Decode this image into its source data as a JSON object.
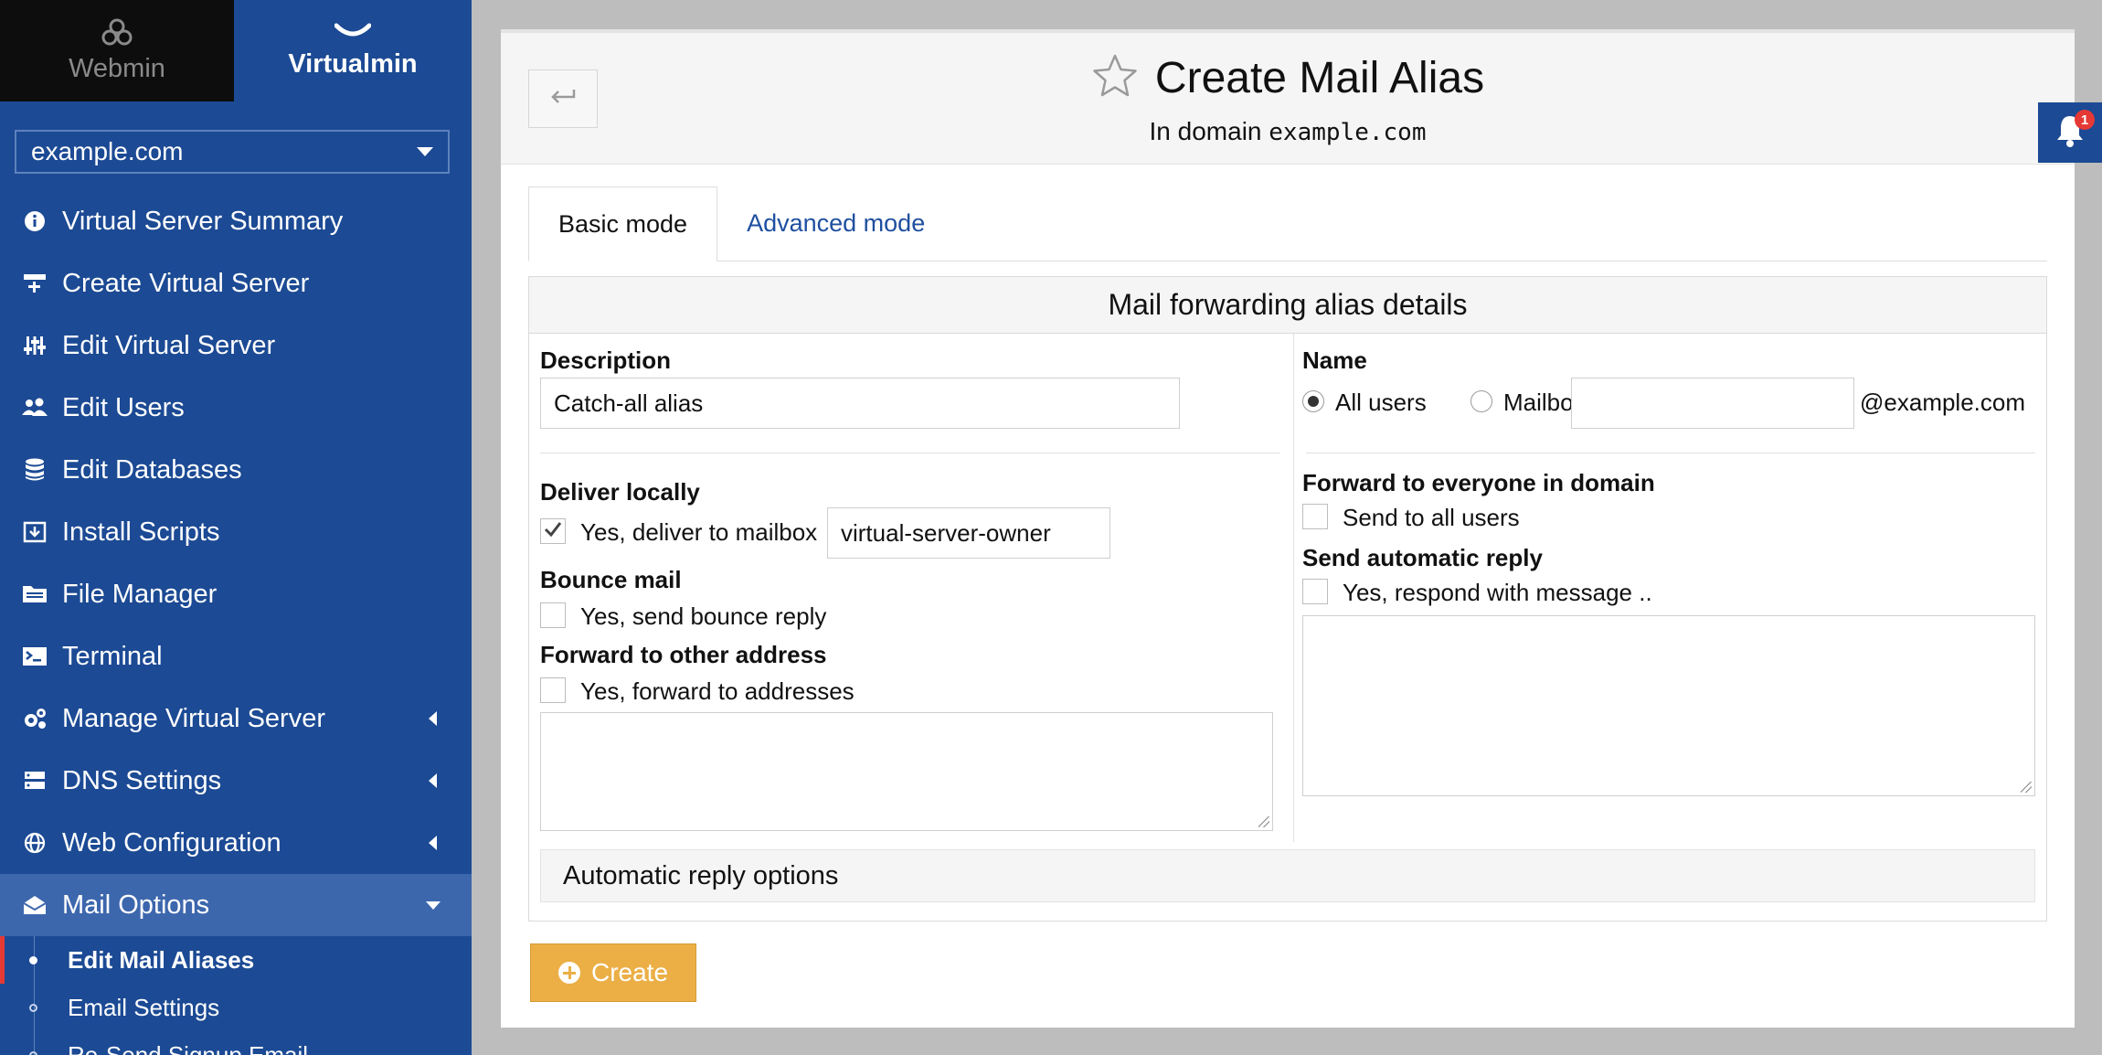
{
  "sidebar": {
    "webmin_label": "Webmin",
    "virtualmin_label": "Virtualmin",
    "domain": "example.com",
    "items": [
      {
        "label": "Virtual Server Summary",
        "icon": "info-icon"
      },
      {
        "label": "Create Virtual Server",
        "icon": "create-server-icon"
      },
      {
        "label": "Edit Virtual Server",
        "icon": "sliders-icon"
      },
      {
        "label": "Edit Users",
        "icon": "users-icon"
      },
      {
        "label": "Edit Databases",
        "icon": "database-icon"
      },
      {
        "label": "Install Scripts",
        "icon": "download-icon"
      },
      {
        "label": "File Manager",
        "icon": "folder-icon"
      },
      {
        "label": "Terminal",
        "icon": "terminal-icon"
      },
      {
        "label": "Manage Virtual Server",
        "icon": "gears-icon"
      },
      {
        "label": "DNS Settings",
        "icon": "server-icon"
      },
      {
        "label": "Web Configuration",
        "icon": "globe-icon"
      },
      {
        "label": "Mail Options",
        "icon": "envelope-open-icon"
      }
    ],
    "sub_items": [
      {
        "label": "Edit Mail Aliases"
      },
      {
        "label": "Email Settings"
      },
      {
        "label": "Re-Send Signup Email"
      }
    ]
  },
  "header": {
    "title": "Create Mail Alias",
    "subtitle_prefix": "In domain",
    "subtitle_domain": "example.com"
  },
  "tabs": {
    "basic": "Basic mode",
    "advanced": "Advanced mode"
  },
  "form": {
    "section_title": "Mail forwarding alias details",
    "description_label": "Description",
    "description_value": "Catch-all alias",
    "name_label": "Name",
    "name_all_users": "All users",
    "name_mailbox": "Mailbox",
    "name_mailbox_value": "",
    "name_domain_suffix": "@example.com",
    "deliver_locally_label": "Deliver locally",
    "deliver_locally_option": "Yes, deliver to mailbox",
    "deliver_locally_checked": true,
    "deliver_mailbox_value": "virtual-server-owner",
    "bounce_label": "Bounce mail",
    "bounce_option": "Yes, send bounce reply",
    "forward_other_label": "Forward to other address",
    "forward_other_option": "Yes, forward to addresses",
    "forward_domain_label": "Forward to everyone in domain",
    "forward_domain_option": "Send to all users",
    "auto_reply_label": "Send automatic reply",
    "auto_reply_option": "Yes, respond with message ..",
    "auto_reply_options_title": "Automatic reply options"
  },
  "actions": {
    "create_label": "Create"
  },
  "notifications": {
    "count": "1"
  },
  "colors": {
    "sidebar_bg": "#1c4a94",
    "accent_button": "#ebaf46",
    "link": "#1f4fa0",
    "badge": "#e53935"
  }
}
